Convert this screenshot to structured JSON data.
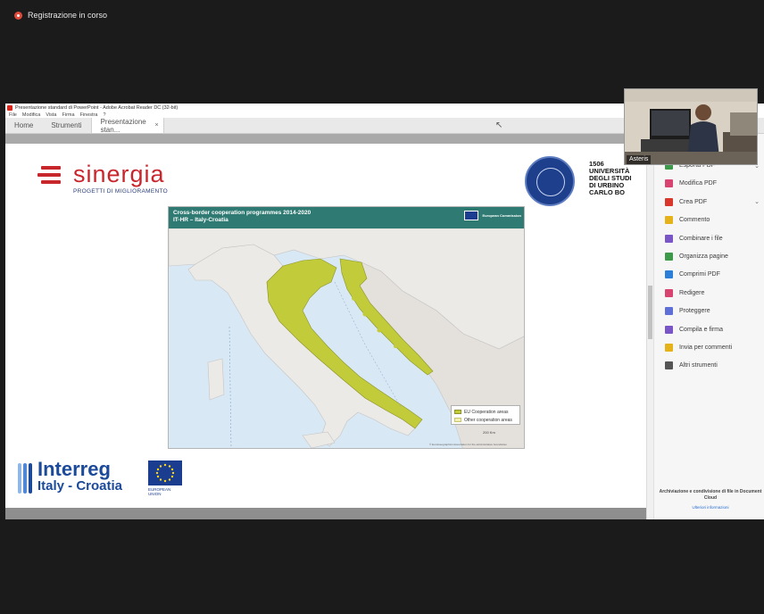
{
  "recording": {
    "label": "Registrazione in corso"
  },
  "window": {
    "title": "Presentazione standard di PowerPoint - Adobe Acrobat Reader DC (32-bit)",
    "menu": [
      "File",
      "Modifica",
      "Vista",
      "Firma",
      "Finestra",
      "?"
    ],
    "tabs": {
      "home": "Home",
      "tools": "Strumenti",
      "document": "Presentazione stan...",
      "close": "×"
    }
  },
  "slide": {
    "sinergia": {
      "word": "sinergia",
      "subtitle": "PROGETTI DI MIGLIORAMENTO"
    },
    "university": {
      "line1": "1506",
      "line2": "UNIVERSITÀ",
      "line3": "DEGLI STUDI",
      "line4": "DI URBINO",
      "line5": "CARLO BO"
    },
    "map": {
      "title_line1": "Cross-border cooperation programmes 2014-2020",
      "title_line2": "IT-HR – Italy-Croatia",
      "commission": "European Commission",
      "legend": [
        "EU Cooperation areas",
        "Other cooperation areas"
      ],
      "scale": "200 Km",
      "credit": "© EuroGeographics Association for the administrative boundaries"
    },
    "interreg": {
      "word": "Interreg",
      "subtitle": "Italy - Croatia",
      "eu": "EUROPEAN UNION"
    }
  },
  "tools_panel": {
    "items": [
      {
        "label": "Esporta PDF",
        "icon": "export-pdf-icon",
        "color": "#3d9a4a",
        "chevron": true
      },
      {
        "label": "Modifica PDF",
        "icon": "edit-pdf-icon",
        "color": "#d8436f",
        "chevron": false
      },
      {
        "label": "Crea PDF",
        "icon": "create-pdf-icon",
        "color": "#d9362c",
        "chevron": true
      },
      {
        "label": "Commento",
        "icon": "comment-icon",
        "color": "#e5b21a",
        "chevron": false
      },
      {
        "label": "Combinare i file",
        "icon": "combine-files-icon",
        "color": "#7a55c8",
        "chevron": false
      },
      {
        "label": "Organizza pagine",
        "icon": "organize-pages-icon",
        "color": "#3d9a4a",
        "chevron": false
      },
      {
        "label": "Comprimi PDF",
        "icon": "compress-pdf-icon",
        "color": "#2b7fd8",
        "chevron": false
      },
      {
        "label": "Redigere",
        "icon": "redact-icon",
        "color": "#d8436f",
        "chevron": false
      },
      {
        "label": "Proteggere",
        "icon": "protect-icon",
        "color": "#5f6fd8",
        "chevron": false
      },
      {
        "label": "Compila e firma",
        "icon": "fill-sign-icon",
        "color": "#7a55c8",
        "chevron": false
      },
      {
        "label": "Invia per commenti",
        "icon": "send-comments-icon",
        "color": "#e5b21a",
        "chevron": false
      },
      {
        "label": "Altri strumenti",
        "icon": "more-tools-icon",
        "color": "#555555",
        "chevron": false
      }
    ],
    "cloud_text": "Archiviazione e condivisione di file in Document Cloud",
    "cloud_link": "Ulteriori informazioni"
  },
  "webcam": {
    "name": "Asteris"
  }
}
